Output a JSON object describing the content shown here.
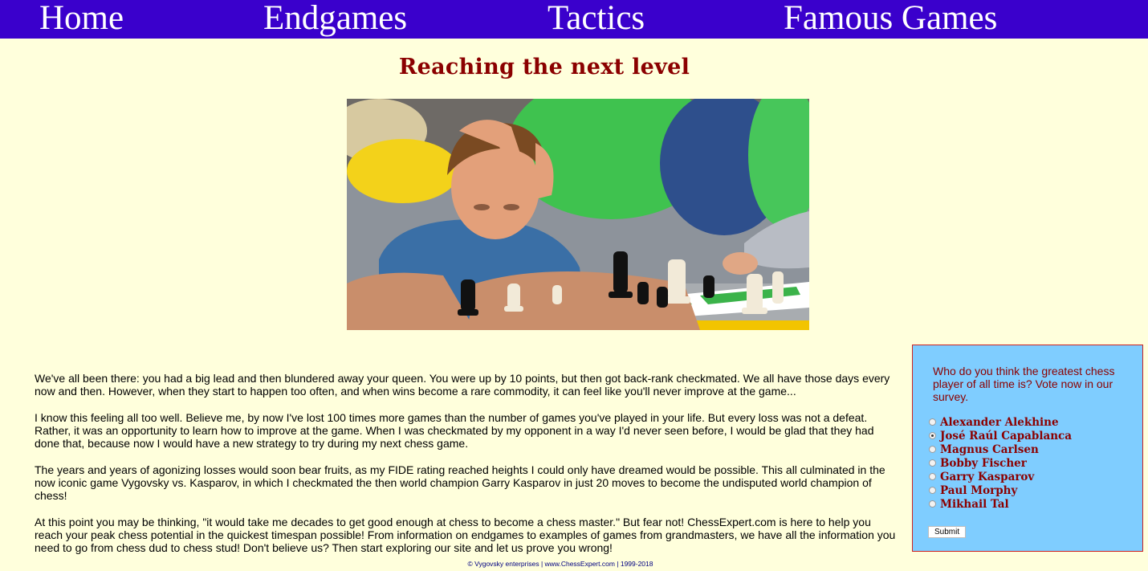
{
  "nav": {
    "home": "Home",
    "endgames": "Endgames",
    "tactics": "Tactics",
    "famous_games": "Famous Games"
  },
  "page_title": "Reaching the next level",
  "article": {
    "paragraphs": [
      "We've all been there: you had a big lead and then blundered away your queen. You were up by 10 points, but then got back-rank checkmated. We all have those days every now and then. However, when they start to happen too often, and when wins become a rare commodity, it can feel like you'll never improve at the game...",
      "I know this feeling all too well. Believe me, by now I've lost 100 times more games than the number of games you've played in your life. But every loss was not a defeat. Rather, it was an opportunity to learn how to improve at the game. When I was checkmated by my opponent in a way I'd never seen before, I would be glad that they had done that, because now I would have a new strategy to try during my next chess game.",
      "The years and years of agonizing losses would soon bear fruits, as my FIDE rating reached heights I could only have dreamed would be possible. This all culminated in the now iconic game Vygovsky vs. Kasparov, in which I checkmated the then world champion Garry Kasparov in just 20 moves to become the undisputed world champion of chess!",
      "At this point you may be thinking, \"it would take me decades to get good enough at chess to become a chess master.\" But fear not! ChessExpert.com is here to help you reach your peak chess potential in the quickest timespan possible! From information on endgames to examples of games from grandmasters, we have all the information you need to go from chess dud to chess stud! Don't believe us? Then start exploring our site and let us prove you wrong!"
    ]
  },
  "survey": {
    "question": "Who do you think the greatest chess player of all time is? Vote now in our survey.",
    "options": [
      {
        "label": "Alexander Alekhine",
        "checked": false
      },
      {
        "label": "José Raúl Capablanca",
        "checked": true
      },
      {
        "label": "Magnus Carlsen",
        "checked": false
      },
      {
        "label": "Bobby Fischer",
        "checked": false
      },
      {
        "label": "Garry Kasparov",
        "checked": false
      },
      {
        "label": "Paul Morphy",
        "checked": false
      },
      {
        "label": "Mikhail Tal",
        "checked": false
      }
    ],
    "submit_label": "Submit"
  },
  "footer": "© Vygovsky enterprises | www.ChessExpert.com | 1999-2018",
  "colors": {
    "nav_bg": "#3a00cc",
    "page_bg": "#ffffdc",
    "title": "#8b0000",
    "survey_bg": "#7fcdff",
    "survey_border": "#cc2222"
  }
}
